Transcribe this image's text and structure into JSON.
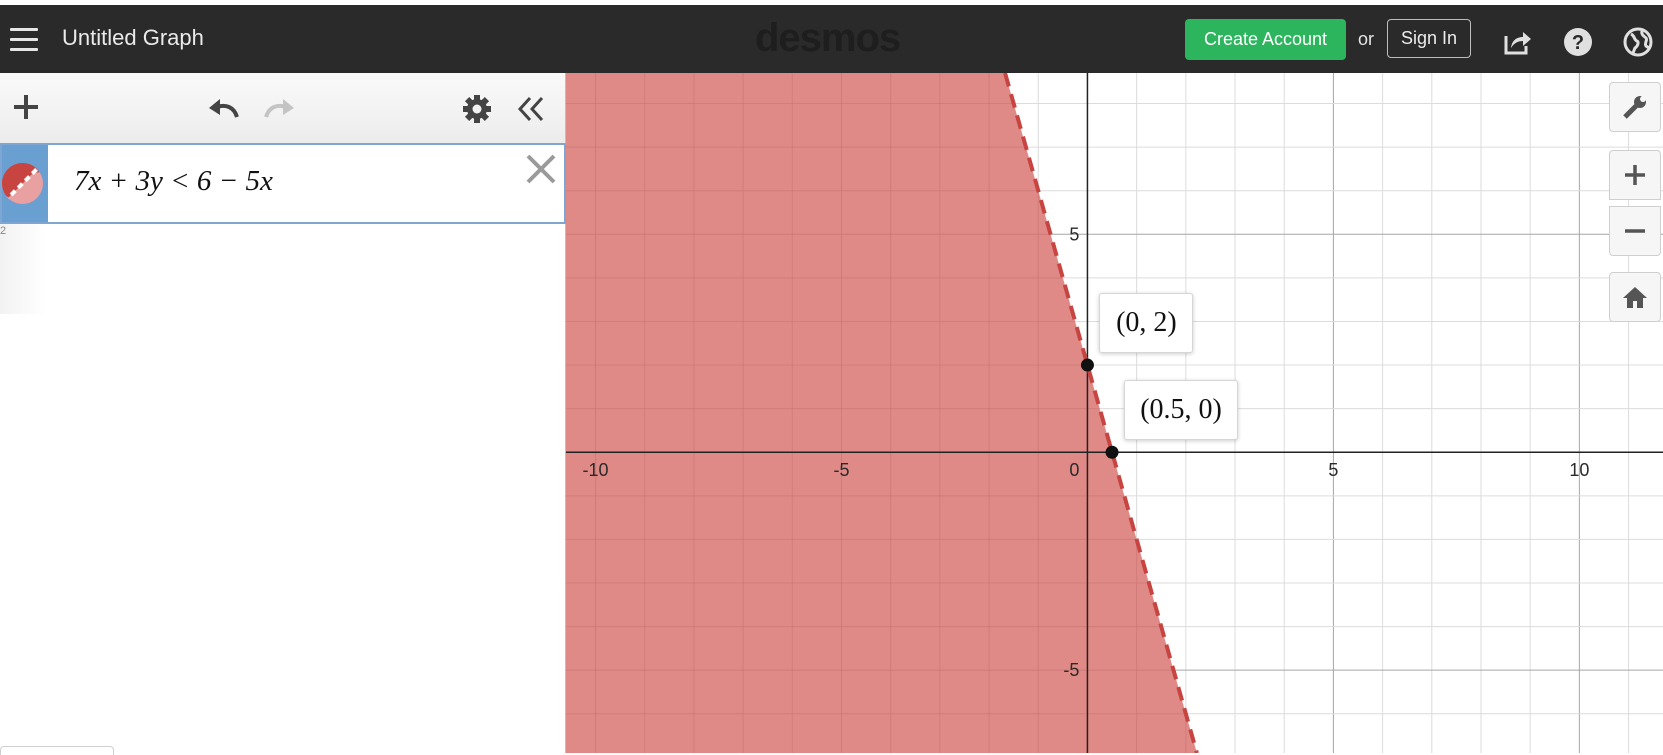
{
  "header": {
    "title": "Untitled Graph",
    "logo": "desmos",
    "create_account_label": "Create Account",
    "or_label": "or",
    "sign_in_label": "Sign In",
    "icons": [
      "menu-icon",
      "share-icon",
      "help-icon",
      "globe-icon"
    ]
  },
  "sidebar": {
    "toolbar_icons": [
      "add-icon",
      "undo-icon",
      "redo-icon",
      "settings-icon",
      "collapse-icon"
    ],
    "expression": {
      "latex": "7x + 3y < 6 − 5x",
      "color": "#c74440"
    },
    "empty_index": "2"
  },
  "graph": {
    "x_range": [
      -10.6,
      11.7
    ],
    "y_range": [
      -6.9,
      8.7
    ],
    "x_ticks": [
      {
        "value": -10,
        "label": "-10"
      },
      {
        "value": -5,
        "label": "-5"
      },
      {
        "value": 5,
        "label": "5"
      },
      {
        "value": 10,
        "label": "10"
      }
    ],
    "y_ticks": [
      {
        "value": 5,
        "label": "5"
      },
      {
        "value": -5,
        "label": "-5"
      }
    ],
    "origin_label": "0",
    "shade_color": "#dd8481",
    "boundary_color": "#c74440",
    "points": [
      {
        "x": 0,
        "y": 2,
        "label": "(0, 2)"
      },
      {
        "x": 0.5,
        "y": 0,
        "label": "(0.5, 0)"
      }
    ],
    "control_icons": [
      "wrench-icon",
      "zoom-in-icon",
      "zoom-out-icon",
      "home-icon"
    ]
  }
}
